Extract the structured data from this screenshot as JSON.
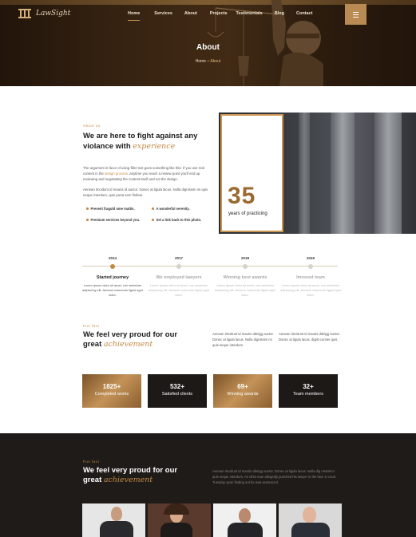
{
  "brand": {
    "name": "LawSight"
  },
  "nav": {
    "items": [
      {
        "label": "Home",
        "active": true
      },
      {
        "label": "Services",
        "active": false
      },
      {
        "label": "About",
        "active": false
      },
      {
        "label": "Projects",
        "active": false
      },
      {
        "label": "Testimonials",
        "active": false
      },
      {
        "label": "Blog",
        "active": false
      },
      {
        "label": "Contact",
        "active": false
      }
    ]
  },
  "hero": {
    "title": "About",
    "breadcrumb": {
      "home": "Home",
      "separator": "»",
      "current": "About"
    }
  },
  "about": {
    "eyebrow": "About us",
    "title_line1": "We are here to fight against any",
    "title_line2": "violance with",
    "title_accent": "experience",
    "para1_a": "The argument in favor of using filler text goes something like this: If you use real content in the",
    "para1_link": "design process",
    "para1_b": ", anytime you reach a review point you'll end up reviewing and negotiating the content itself and not the design.",
    "para2": "Aenean tincidunt id mauris id auctor. Donec at ligula lacus. Nulla dignissim mi quis neque interdum, quis porta sem finibus.",
    "checks": [
      "Prevent fraguld ome mattis.",
      "A wonderful serenity.",
      "Premium services beyond you.",
      "Set a link back to this photo."
    ],
    "years_number": "35",
    "years_label": "years of practicing"
  },
  "timeline": [
    {
      "year": "2014",
      "title": "Started journey",
      "text": "Lorem ipsum dolor sit amet, con sectetuer adipiscing elit. Aenean commodo ligula eget dolor.",
      "active": true
    },
    {
      "year": "2017",
      "title": "We employed lawyers",
      "text": "Lorem ipsum dolor sit amet, con sectetuer adipiscing elit. Aenean commodo ligula eget dolor.",
      "active": false
    },
    {
      "year": "2018",
      "title": "Winning best awards",
      "text": "Lorem ipsum dolor sit amet, con sectetuer adipiscing elit. Aenean commodo ligula eget dolor.",
      "active": false
    },
    {
      "year": "2019",
      "title": "Imroved team",
      "text": "Lorem ipsum dolor sit amet, con sectetuer adipiscing elit. Aenean commodo ligula eget dolor.",
      "active": false
    }
  ],
  "achievement": {
    "eyebrow": "Fun fact",
    "title_line1": "We feel very proud for our",
    "title_line2": "great",
    "title_accent": "achievement",
    "col1": "Aenean tincidunt id mauris ddelgg auctor. Donec at ligula lacus. Nulla dignissim mi quis neque interdum.",
    "col2": "Aenean tincidunt id mauris ddelgg auctor. Donec at ligula lacus. digist comier quis.",
    "stats": [
      {
        "number": "1825+",
        "label": "Completed works",
        "style": "gold"
      },
      {
        "number": "532+",
        "label": "Satisfied clients",
        "style": "black"
      },
      {
        "number": "69+",
        "label": "Winning awards",
        "style": "gold"
      },
      {
        "number": "32+",
        "label": "Team members",
        "style": "black"
      }
    ]
  },
  "dark_section": {
    "eyebrow": "Fun fact",
    "title_line1": "We feel very proud for our",
    "title_line2": "great",
    "title_accent": "achievement",
    "text": "Aenean tincidunt id mauris ddelgg auctor. Donec at ligula lacus. Nulla dig nissimmi quis neque interdum. As Ohio man allegedly punched his lawyer in the face in court Tuesday upon finding out he was sentenced."
  },
  "colors": {
    "accent": "#c58a44",
    "dark": "#1f1b18",
    "gold_button": "#b98a52"
  }
}
